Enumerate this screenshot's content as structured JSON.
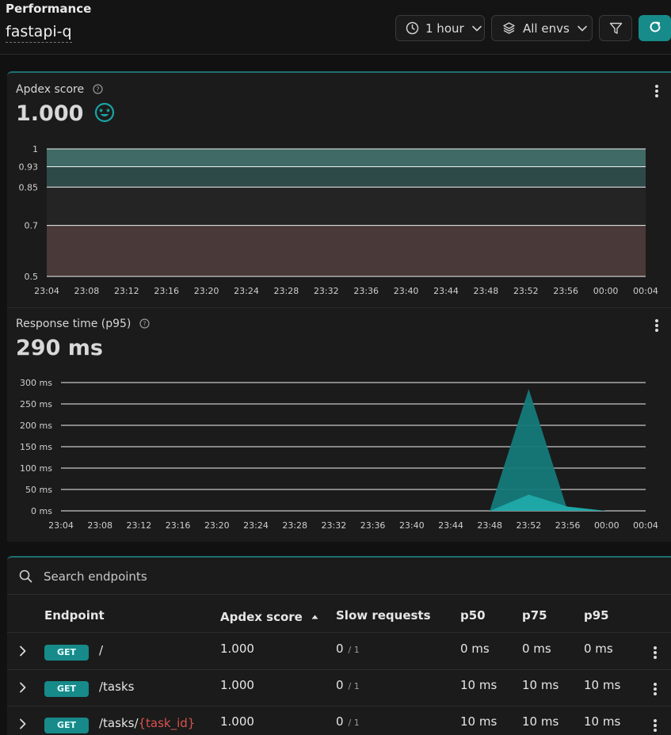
{
  "header": {
    "section_title": "Performance",
    "app_name": "fastapi-q",
    "time_range": "1 hour",
    "environment": "All envs",
    "icons": {
      "time": "clock-icon",
      "env": "layers-icon",
      "filter": "filter-icon",
      "refresh": "refresh-icon"
    }
  },
  "apdex_panel": {
    "title": "Apdex score",
    "value": "1.000",
    "status_icon": "smiley-star-eyes-icon",
    "chart_data": {
      "type": "area",
      "ylabels": [
        "1",
        "0.93",
        "0.85",
        "0.7",
        "0.5"
      ],
      "yticks": [
        1,
        0.93,
        0.85,
        0.7,
        0.5
      ],
      "ylim": [
        0.5,
        1
      ],
      "bands": [
        {
          "from": 0.93,
          "to": 1,
          "color": "#3f6a66"
        },
        {
          "from": 0.85,
          "to": 0.93,
          "color": "#2e4a48"
        },
        {
          "from": 0.7,
          "to": 0.85,
          "color": "#242424"
        },
        {
          "from": 0.5,
          "to": 0.7,
          "color": "#4a3939"
        }
      ],
      "x": [
        "23:04",
        "23:08",
        "23:12",
        "23:16",
        "23:20",
        "23:24",
        "23:28",
        "23:32",
        "23:36",
        "23:40",
        "23:44",
        "23:48",
        "23:52",
        "23:56",
        "00:00",
        "00:04"
      ],
      "series": [
        {
          "points": [
            {
              "x": 23.4,
              "y": 1
            },
            {
              "x": 23.6,
              "y": 1
            },
            {
              "x": 23.8,
              "y": 1
            },
            {
              "x": 24.0,
              "y": 1
            }
          ]
        }
      ],
      "series_color": "#1aa3a3"
    }
  },
  "response_panel": {
    "title": "Response time (p95)",
    "value": "290 ms",
    "chart_data": {
      "type": "area",
      "ylabels": [
        "300 ms",
        "250 ms",
        "200 ms",
        "150 ms",
        "100 ms",
        "50 ms",
        "0 ms"
      ],
      "yticks": [
        300,
        250,
        200,
        150,
        100,
        50,
        0
      ],
      "ylim": [
        0,
        300
      ],
      "x": [
        "23:04",
        "23:08",
        "23:12",
        "23:16",
        "23:20",
        "23:24",
        "23:28",
        "23:32",
        "23:36",
        "23:40",
        "23:44",
        "23:48",
        "23:52",
        "23:56",
        "00:00",
        "00:04"
      ],
      "series": [
        {
          "color": "#157a7a",
          "points": [
            {
              "x": 22,
              "y": 0
            },
            {
              "x": 24,
              "y": 285
            },
            {
              "x": 26,
              "y": 0
            }
          ]
        },
        {
          "color": "#1fa6a6",
          "points": [
            {
              "x": 22,
              "y": 0
            },
            {
              "x": 24,
              "y": 38
            },
            {
              "x": 26,
              "y": 10
            },
            {
              "x": 28,
              "y": 0
            }
          ]
        }
      ]
    }
  },
  "table": {
    "search_placeholder": "Search endpoints",
    "search_icon": "search-icon",
    "columns": {
      "endpoint": "Endpoint",
      "apdex": "Apdex score",
      "slow": "Slow requests",
      "p50": "p50",
      "p75": "p75",
      "p95": "p95"
    },
    "rows": [
      {
        "method": "GET",
        "path": "/",
        "param": "",
        "apdex": "1.000",
        "slow": "0",
        "slow_total": "/ 1",
        "p50": "0 ms",
        "p75": "0 ms",
        "p95": "0 ms"
      },
      {
        "method": "GET",
        "path": "/tasks",
        "param": "",
        "apdex": "1.000",
        "slow": "0",
        "slow_total": "/ 1",
        "p50": "10 ms",
        "p75": "10 ms",
        "p95": "10 ms"
      },
      {
        "method": "GET",
        "path": "/tasks/",
        "param": "{task_id}",
        "apdex": "1.000",
        "slow": "0",
        "slow_total": "/ 1",
        "p50": "10 ms",
        "p75": "10 ms",
        "p95": "10 ms"
      }
    ]
  }
}
